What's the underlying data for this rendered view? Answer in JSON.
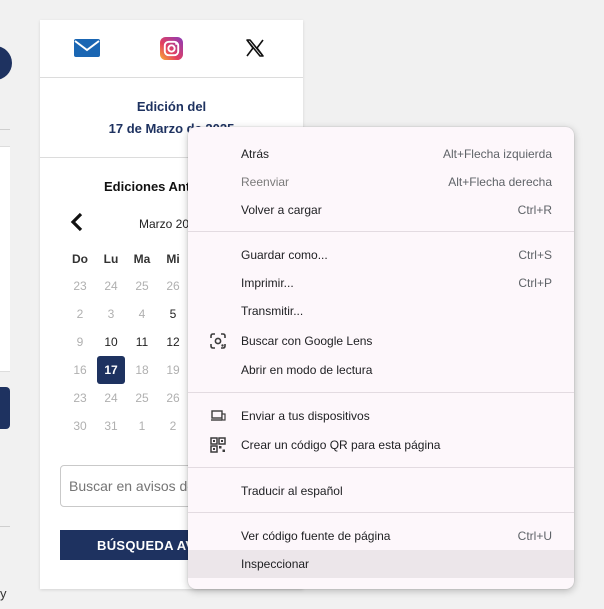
{
  "background_left": {
    "trailing_char": "y"
  },
  "card": {
    "social_icons": [
      "mail-icon",
      "instagram-icon",
      "x-icon"
    ],
    "edition_line1": "Edición del",
    "edition_line2": "17 de Marzo de 2025",
    "previous_title": "Ediciones Anteriores",
    "calendar": {
      "month": "Marzo 2025",
      "weekdays": [
        "Do",
        "Lu",
        "Ma",
        "Mi"
      ],
      "weeks": [
        [
          "23",
          "24",
          "25",
          "26"
        ],
        [
          "2",
          "3",
          "4",
          "5"
        ],
        [
          "9",
          "10",
          "11",
          "12"
        ],
        [
          "16",
          "17",
          "18",
          "19"
        ],
        [
          "23",
          "24",
          "25",
          "26"
        ],
        [
          "30",
          "31",
          "1",
          "2"
        ]
      ],
      "selected": "17"
    },
    "search_placeholder": "Buscar en avisos de",
    "search_button": "BÚSQUEDA AVANZADA"
  },
  "context_menu": {
    "back": "Atrás",
    "back_shortcut": "Alt+Flecha izquierda",
    "forward": "Reenviar",
    "forward_shortcut": "Alt+Flecha derecha",
    "reload": "Volver a cargar",
    "reload_shortcut": "Ctrl+R",
    "save_as": "Guardar como...",
    "save_as_shortcut": "Ctrl+S",
    "print": "Imprimir...",
    "print_shortcut": "Ctrl+P",
    "cast": "Transmitir...",
    "lens": "Buscar con Google Lens",
    "reading_mode": "Abrir en modo de lectura",
    "send_devices": "Enviar a tus dispositivos",
    "qr_code": "Crear un código QR para esta página",
    "translate": "Traducir al español",
    "view_source": "Ver código fuente de página",
    "view_source_shortcut": "Ctrl+U",
    "inspect": "Inspeccionar"
  },
  "colors": {
    "brand_navy": "#1e3260",
    "menu_bg": "#fdf7fb",
    "hover_bg": "#ece6ea"
  }
}
